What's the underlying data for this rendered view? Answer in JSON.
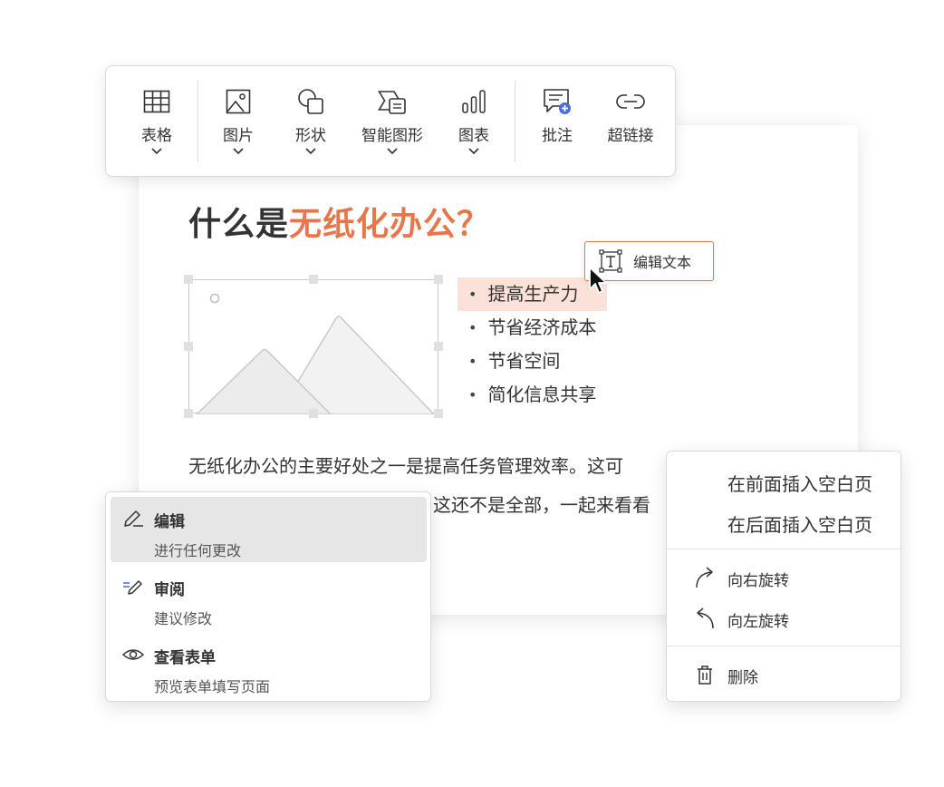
{
  "toolbar": {
    "items": [
      {
        "label": "表格",
        "icon": "table-icon",
        "has_dropdown": true
      },
      {
        "label": "图片",
        "icon": "image-icon",
        "has_dropdown": true
      },
      {
        "label": "形状",
        "icon": "shapes-icon",
        "has_dropdown": true
      },
      {
        "label": "智能图形",
        "icon": "smartart-icon",
        "has_dropdown": true
      },
      {
        "label": "图表",
        "icon": "chart-icon",
        "has_dropdown": true
      },
      {
        "label": "批注",
        "icon": "comment-add-icon",
        "has_dropdown": false
      },
      {
        "label": "超链接",
        "icon": "link-icon",
        "has_dropdown": false
      }
    ]
  },
  "document": {
    "title_prefix": "什么是",
    "title_highlight": "无纸化办公？",
    "bullets": [
      "提高生产力",
      "节省经济成本",
      "节省空间",
      "简化信息共享"
    ],
    "body_line1": "无纸化办公的主要好处之一是提高任务管理效率。这可",
    "body_line2": "这还不是全部，一起来看看"
  },
  "edit_text_tooltip": {
    "label": "编辑文本",
    "icon": "text-box-icon"
  },
  "left_menu": {
    "items": [
      {
        "title": "编辑",
        "subtitle": "进行任何更改",
        "icon": "pencil-icon",
        "active": true
      },
      {
        "title": "审阅",
        "subtitle": "建议修改",
        "icon": "review-icon",
        "active": false
      },
      {
        "title": "查看表单",
        "subtitle": "预览表单填写页面",
        "icon": "eye-icon",
        "active": false
      }
    ]
  },
  "right_menu": {
    "insert_before": "在前面插入空白页",
    "insert_after": "在后面插入空白页",
    "rotate_right": "向右旋转",
    "rotate_left": "向左旋转",
    "delete": "删除"
  },
  "colors": {
    "accent": "#e7774a",
    "highlight_bg": "#fbe1d7",
    "menu_active_bg": "#e6e6e6",
    "comment_badge": "#4a6fd6"
  }
}
